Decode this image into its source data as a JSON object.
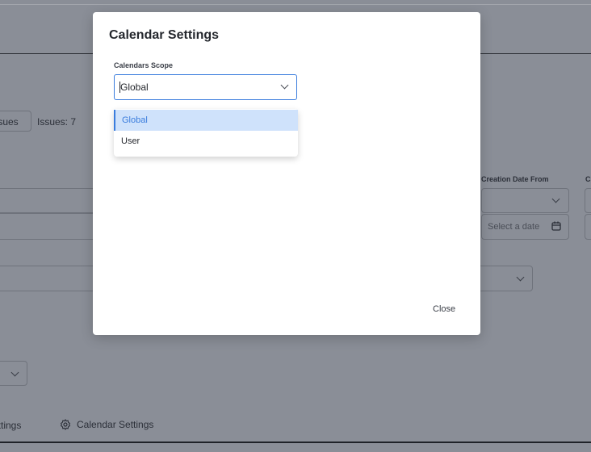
{
  "background": {
    "issues_button": "Issues",
    "issues_count": "Issues: 7",
    "creation_date_from_label": "Creation Date From",
    "creation_date_to_label_partial": "C",
    "date_placeholder": "Select a date",
    "tab_settings_partial": "Settings",
    "tab_calendar_settings": "Calendar Settings"
  },
  "modal": {
    "title": "Calendar Settings",
    "scope_label": "Calendars Scope",
    "scope_value": "Global",
    "options": [
      "Global",
      "User"
    ],
    "selected_option": "Global",
    "close_label": "Close"
  },
  "colors": {
    "accent": "#3b7ddd",
    "highlight": "#cfe2fb",
    "overlay": "#8a8e97"
  }
}
